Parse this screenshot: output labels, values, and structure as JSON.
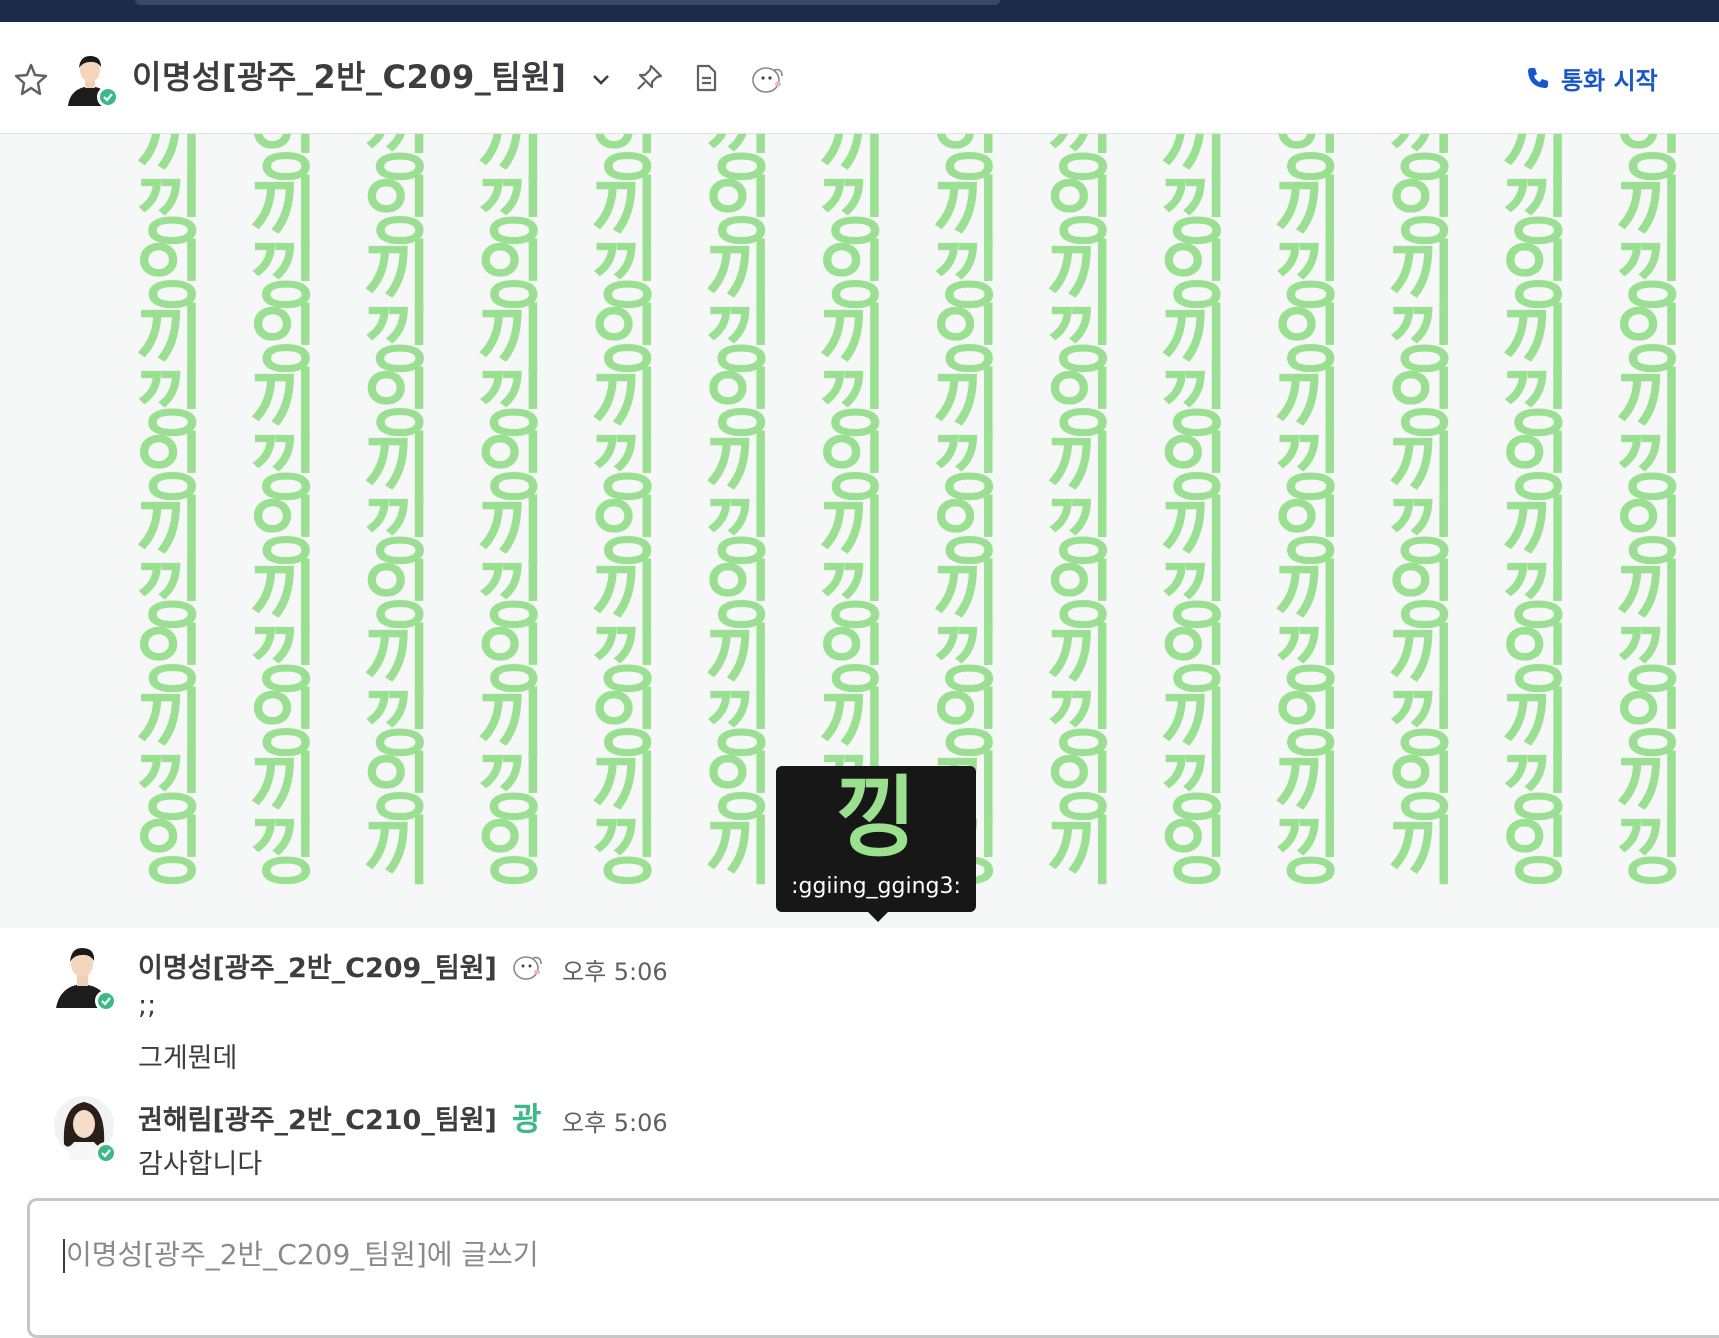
{
  "header": {
    "channel_name": "이명성[광주_2반_C209_팀원]",
    "call_label": "통화 시작"
  },
  "banner": {
    "pattern_glyphs": [
      "끼",
      "잉",
      "낑"
    ],
    "pattern_rows": [
      "끼 잉 낑 끼 잉 낑 끼 잉 낑 끼 잉 낑 끼 잉 낑 끼 잉 낑 끼 잉 낑 끼 잉",
      "낑 끼 잉 낑 끼 잉 낑 끼 잉 낑 끼 잉 낑 끼 잉 낑 끼 잉 낑 끼 잉 낑 끼",
      "잉 낑 끼 잉 낑 끼 잉 낑 끼 잉 낑 끼 잉 낑 끼 잉 낑 끼 잉 낑 끼 잉 낑",
      "끼 잉 낑 끼 잉 낑 끼 잉 낑 끼 잉 낑 끼 잉 낑 끼 잉 낑 끼 잉 낑 끼 잉",
      "낑 끼 잉 낑 끼 잉 낑 끼 잉 낑 끼 잉 낑 끼 잉 낑 끼 잉 낑 끼 잉 낑 끼",
      "잉 낑 끼 잉 낑 끼 잉 낑 끼 잉 낑 끼 잉 낑 끼 잉 낑 끼 잉 낑 끼 잉 낑",
      "끼 잉 낑 끼 잉 낑 끼 잉 낑 끼 잉 낑 끼 잉 낑 끼 잉 낑 끼 잉 낑 끼 잉",
      "낑 끼 잉 낑 끼 잉 낑 끼 잉 낑 끼 잉 낑 끼 잉 낑 끼 잉 낑 끼 잉 낑 끼",
      "잉 낑 끼 잉 낑 끼 잉 낑 끼 잉 낑 끼 잉 낑 끼 잉 낑 끼 잉 낑 끼 잉 낑",
      "끼 잉 낑 끼 잉 낑 끼 잉 낑 끼 잉 낑 끼 잉 낑 끼 잉 낑 끼 잉 낑 끼 잉",
      "낑 끼 잉 낑 끼 잉 낑 끼 잉 낑 끼 잉 낑 끼 잉 낑 끼 잉 낑 끼 잉 낑 끼",
      "잉 낑 끼 잉 낑 끼 잉 낑 끼 잉 낑 끼 잉 낑 끼 잉 낑 끼 잉 낑 끼 잉 낑"
    ],
    "tooltip_glyph": "낑",
    "tooltip_code": ":ggiing_gging3:"
  },
  "messages": [
    {
      "author": "이명성[광주_2반_C209_팀원]",
      "time": "오후 5:06",
      "lines": [
        ";;",
        "그게뭔데"
      ]
    },
    {
      "author": "권해림[광주_2반_C210_팀원]",
      "badge": "광",
      "time": "오후 5:06",
      "lines": [
        "감사합니다"
      ]
    }
  ],
  "composer": {
    "placeholder": "이명성[광주_2반_C209_팀원]에 글쓰기"
  },
  "colors": {
    "pattern_green": "#9bdf92",
    "status_green": "#3db887",
    "link_blue": "#1a56c9",
    "topbar": "#1e2a4a"
  },
  "icons": [
    "star-icon",
    "chevron-down-icon",
    "pin-icon",
    "document-icon",
    "ddung-emoji-icon",
    "phone-icon",
    "check-icon"
  ]
}
